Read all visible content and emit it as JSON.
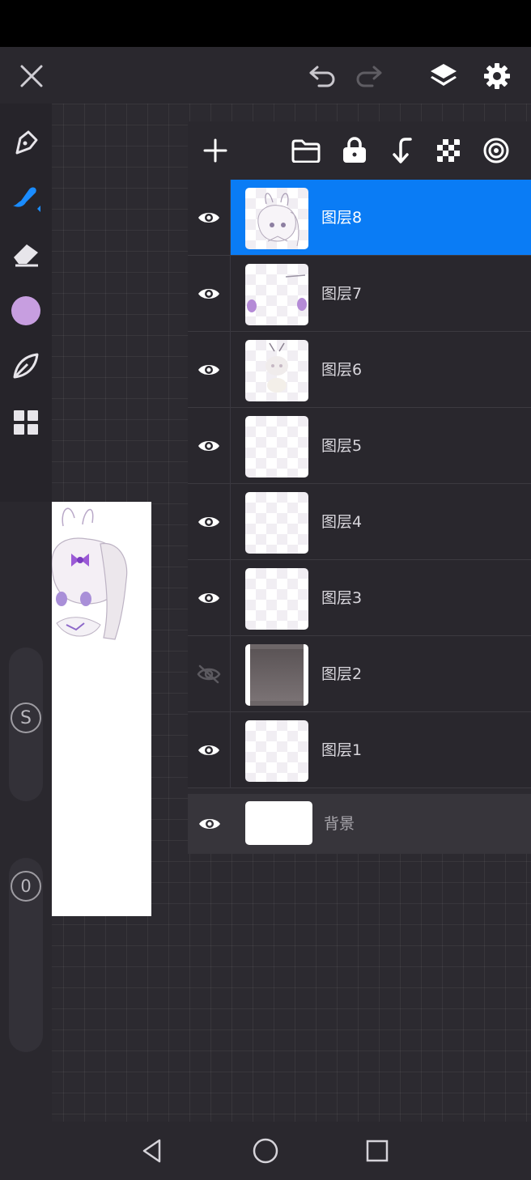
{
  "topbar": {
    "close_icon": "close-icon",
    "undo_icon": "undo-icon",
    "redo_icon": "redo-icon",
    "layers_icon": "layers-icon",
    "settings_icon": "gear-icon"
  },
  "toolbar": {
    "tools": [
      "pen-icon",
      "brush-icon",
      "eraser-icon",
      "color-swatch",
      "leaf-icon",
      "grid-icon"
    ],
    "active_tool": "brush-icon",
    "color": "#c79ee0",
    "accent": "#1a8cff"
  },
  "sidebar": {
    "size_label": "S",
    "opacity_label": "0"
  },
  "layers_panel": {
    "header_icons": [
      "add-layer-icon",
      "folder-icon",
      "lock-icon",
      "merge-down-icon",
      "alpha-lock-icon",
      "blend-mode-icon"
    ],
    "layers": [
      {
        "name": "图层8",
        "visible": true,
        "active": true
      },
      {
        "name": "图层7",
        "visible": true,
        "active": false
      },
      {
        "name": "图层6",
        "visible": true,
        "active": false
      },
      {
        "name": "图层5",
        "visible": true,
        "active": false
      },
      {
        "name": "图层4",
        "visible": true,
        "active": false
      },
      {
        "name": "图层3",
        "visible": true,
        "active": false
      },
      {
        "name": "图层2",
        "visible": false,
        "active": false
      },
      {
        "name": "图层1",
        "visible": true,
        "active": false
      }
    ],
    "background": {
      "name": "背景",
      "visible": true
    }
  },
  "navbar": {
    "back_icon": "back-triangle-icon",
    "home_icon": "home-circle-icon",
    "recents_icon": "recents-square-icon"
  }
}
